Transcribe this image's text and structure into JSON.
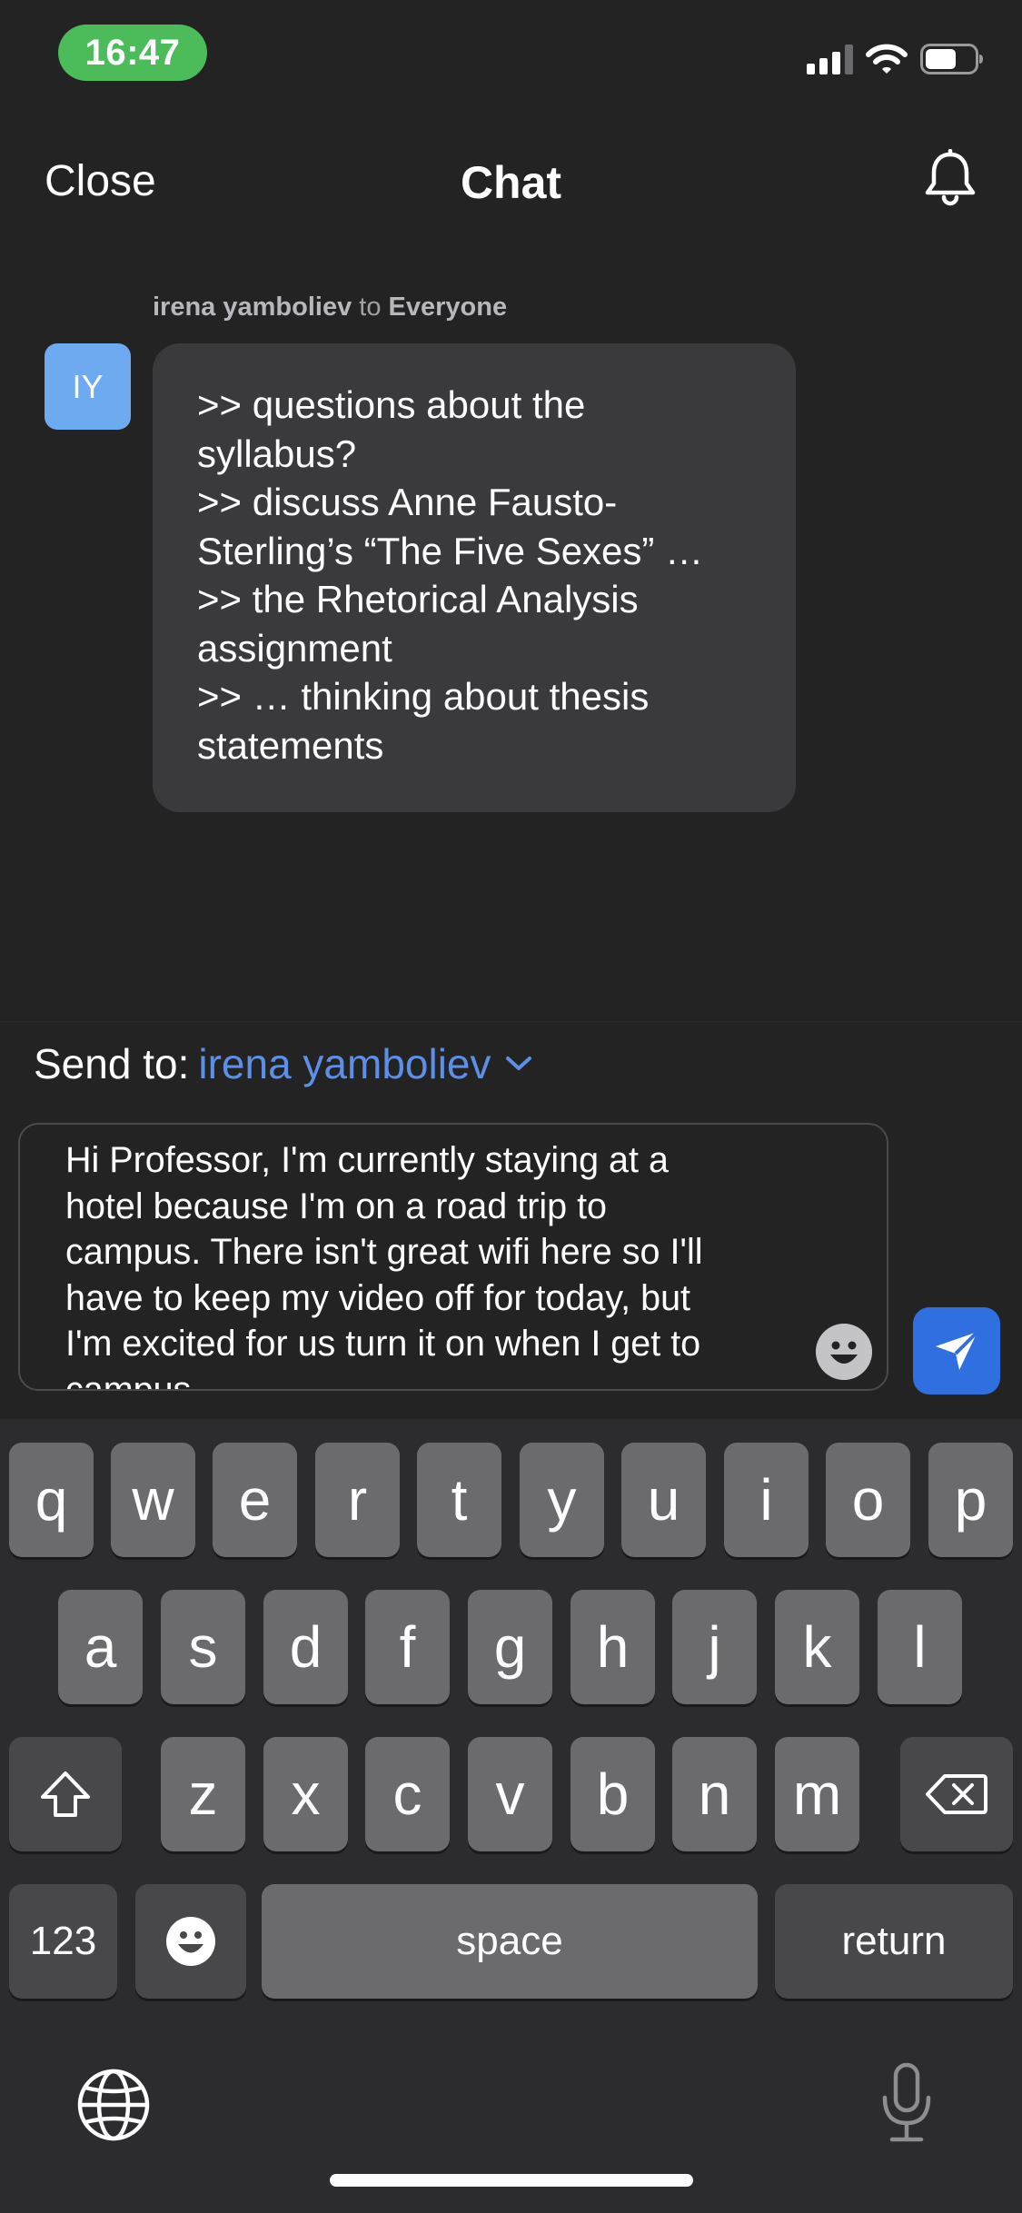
{
  "status_bar": {
    "time": "16:47",
    "icons": [
      "cellular-signal-icon",
      "wifi-icon",
      "battery-icon"
    ]
  },
  "nav": {
    "close_label": "Close",
    "title": "Chat",
    "bell_icon": "bell-icon"
  },
  "message": {
    "sender": "irena yamboliev",
    "to_word": "to",
    "recipient": "Everyone",
    "avatar_initials": "IY",
    "lines": [
      ">> questions about the",
      "syllabus?",
      ">> discuss Anne Fausto-",
      "Sterling’s “The Five Sexes” …",
      ">> the Rhetorical Analysis",
      "assignment",
      ">> … thinking about thesis",
      "statements"
    ]
  },
  "compose": {
    "send_to_label": "Send to:",
    "send_to_value": "irena yamboliev",
    "input_value": "Hi Professor, I'm currently staying at a\nhotel because I'm on a road trip to\ncampus. There isn't great wifi here so I'll\nhave to keep my video off for today, but\nI'm excited for us turn it on when I get to\ncampus."
  },
  "keyboard": {
    "row1": [
      "q",
      "w",
      "e",
      "r",
      "t",
      "y",
      "u",
      "i",
      "o",
      "p"
    ],
    "row2": [
      "a",
      "s",
      "d",
      "f",
      "g",
      "h",
      "j",
      "k",
      "l"
    ],
    "row3": [
      "z",
      "x",
      "c",
      "v",
      "b",
      "n",
      "m"
    ],
    "numbers_label": "123",
    "space_label": "space",
    "return_label": "return"
  },
  "colors": {
    "accent": "#5e8fe6",
    "send_button": "#2f6fdf",
    "avatar": "#6eaaf0",
    "time_pill": "#4cbc5a"
  }
}
